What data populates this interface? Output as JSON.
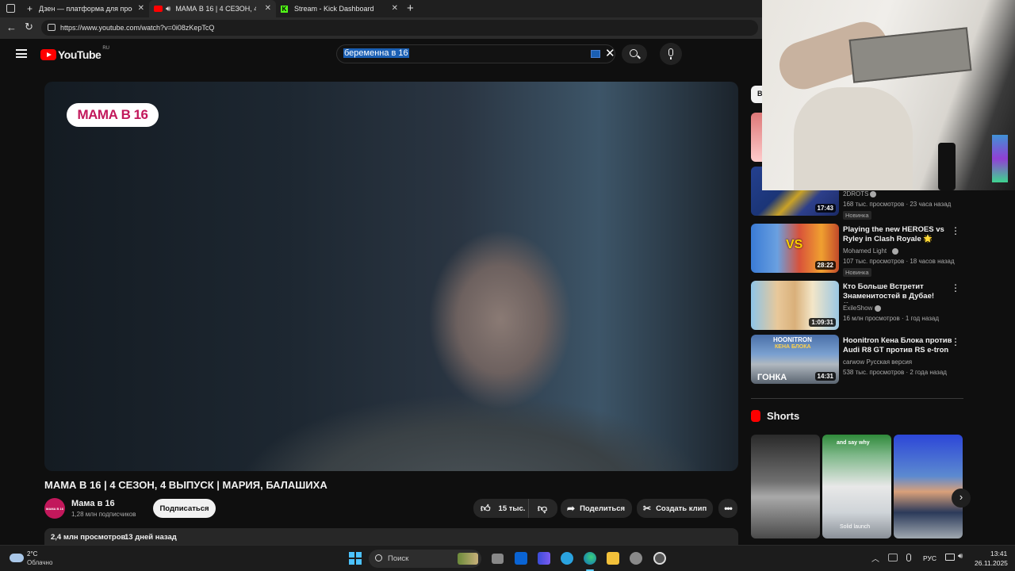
{
  "browser": {
    "tabs": [
      {
        "title": "Дзен — платформа для просмо"
      },
      {
        "title": "МАМА В 16 | 4 СЕЗОН, 4 Вы"
      },
      {
        "title": "Stream - Kick Dashboard"
      }
    ],
    "url": "https://www.youtube.com/watch?v=0i08zKepTcQ"
  },
  "youtube": {
    "logo": "YouTube",
    "region": "RU",
    "search_value": "беременна в 16"
  },
  "video": {
    "overlay_logo": "МАМА В 16",
    "title": "МАМА В 16 | 4 СЕЗОН, 4 ВЫПУСК | МАРИЯ, БАЛАШИХА",
    "channel_name": "Мама в 16",
    "avatar_text": "МАМА В 16",
    "subscribers": "1,28 млн подписчиков",
    "subscribe_label": "Подписаться",
    "likes": "15 тыс.",
    "share_label": "Поделиться",
    "clip_label": "Создать клип",
    "views": "2,4 млн просмотров",
    "date": "13 дней назад"
  },
  "sidebar": {
    "chip": "В",
    "items": [
      {
        "channel": "2DROTS",
        "meta": "168 тыс. просмотров · 23 часа назад",
        "badge": "Новинка",
        "duration": "17:43"
      },
      {
        "title": "Playing the new HEROES vs Ryley in Clash Royale 🌟",
        "channel": "Mohamed Light",
        "meta": "107 тыс. просмотров · 18 часов назад",
        "badge": "Новинка",
        "duration": "28:22",
        "thumb_text": "VS"
      },
      {
        "title": "Кто Больше Встретит Знаменитостей в Дубае! (fea...",
        "channel": "ExileShow",
        "meta": "16 млн просмотров · 1 год назад",
        "duration": "1:09:31"
      },
      {
        "title": "Hoonitron Кена Блока против Audi R8 GT против RS e-tron ...",
        "channel": "carwow Русская версия",
        "meta": "538 тыс. просмотров · 2 года назад",
        "duration": "14:31",
        "thumb_text_top": "HOONITRON",
        "thumb_text_mid": "КЕНА БЛОКА",
        "thumb_text_bottom": "ГОНКА"
      }
    ],
    "shorts_label": "Shorts",
    "shorts": [
      {
        "caption": ""
      },
      {
        "caption_top": "and say why",
        "caption": "Solid launch"
      },
      {
        "caption": ""
      }
    ]
  },
  "taskbar": {
    "weather_temp": "2°C",
    "weather_desc": "Облачно",
    "search_placeholder": "Поиск",
    "lang": "РУС",
    "time": "13:41",
    "date": "26.11.2025"
  },
  "colors": {
    "youtube_red": "#ff0000",
    "kick_green": "#53fc18",
    "edge_blue": "#0f6cbd",
    "logo_pink": "#c2185b"
  }
}
